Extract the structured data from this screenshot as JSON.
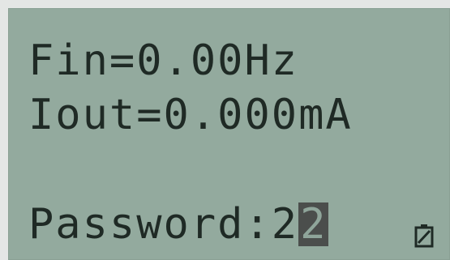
{
  "display": {
    "line1": "Fin=0.00Hz",
    "line2": "Iout=0.000mA",
    "line3": "",
    "password_label": "Password:",
    "password_digits": "2",
    "password_cursor_digit": "2"
  },
  "icons": {
    "battery": "battery-icon"
  },
  "colors": {
    "lcd_background": "#93aa9e",
    "lcd_text": "#1f2a25",
    "cursor_block": "#4b4e4c",
    "bezel": "#e4e6e5"
  }
}
